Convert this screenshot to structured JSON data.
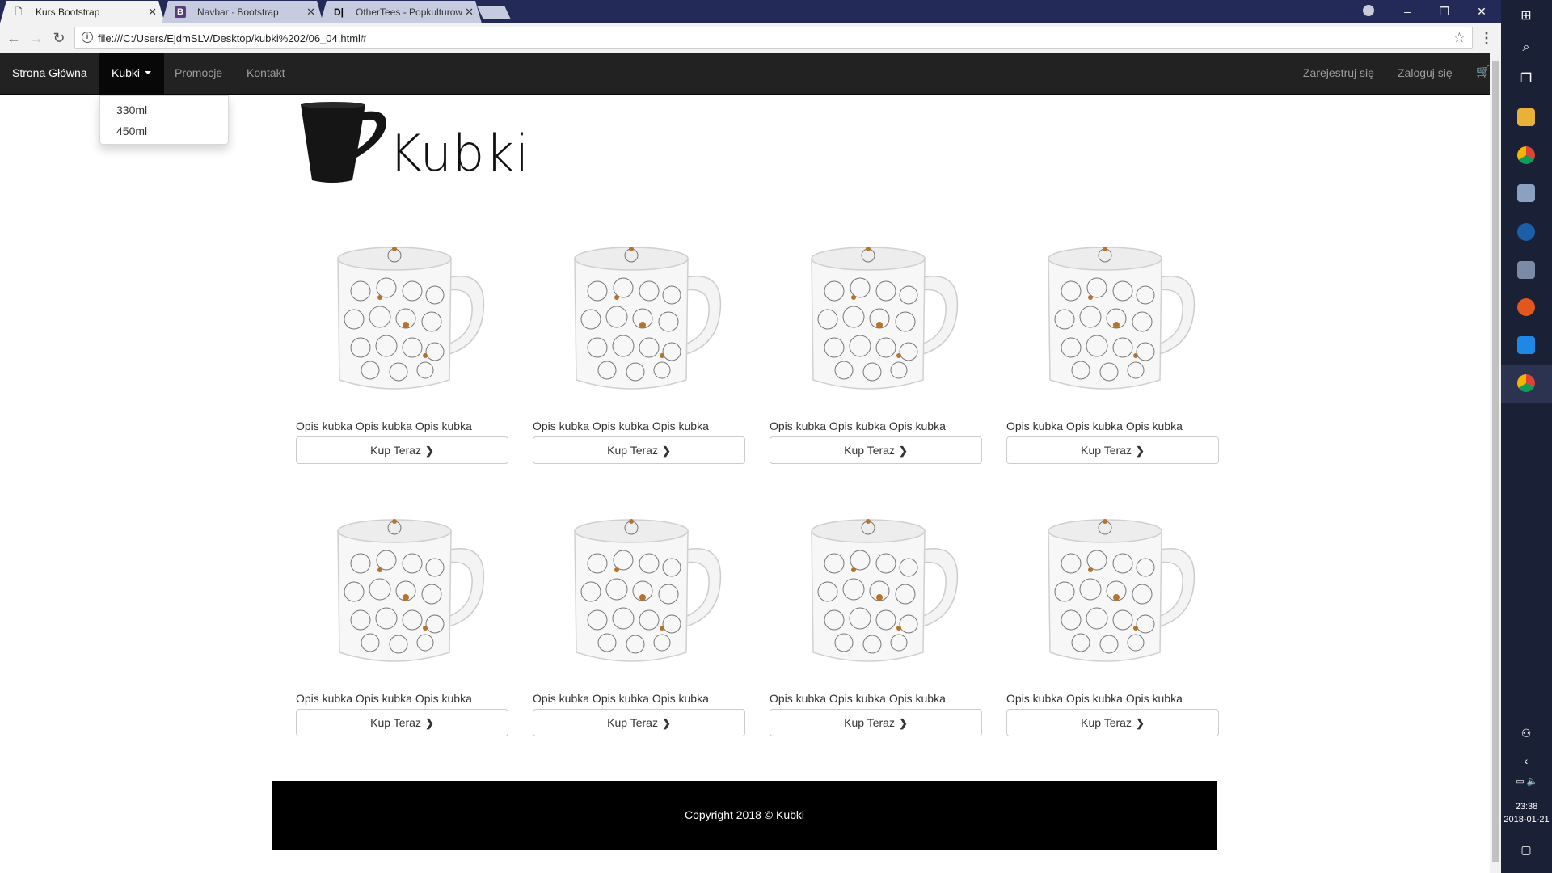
{
  "browser": {
    "tabs": [
      {
        "title": "Kurs Bootstrap",
        "favicon": "page-icon",
        "active": true
      },
      {
        "title": "Navbar · Bootstrap",
        "favicon": "B",
        "active": false
      },
      {
        "title": "OtherTees - Popkulturow",
        "favicon": "D|",
        "active": false
      }
    ],
    "url": "file:///C:/Users/EjdmSLV/Desktop/kubki%202/06_04.html#",
    "window_controls": {
      "minimize": "–",
      "restore": "❐",
      "close": "✕"
    }
  },
  "navbar": {
    "brand": "Strona Główna",
    "items": [
      {
        "label": "Kubki",
        "active": true,
        "dropdown": true
      },
      {
        "label": "Promocje"
      },
      {
        "label": "Kontakt"
      }
    ],
    "right": [
      {
        "label": "Zarejestruj się"
      },
      {
        "label": "Zaloguj się"
      }
    ],
    "cart_icon": "cart-icon"
  },
  "dropdown": {
    "items": [
      "330ml",
      "450ml"
    ]
  },
  "header": {
    "title": "Kubki"
  },
  "products": [
    {
      "desc": "Opis kubka Opis kubka Opis kubka",
      "button": "Kup Teraz"
    },
    {
      "desc": "Opis kubka Opis kubka Opis kubka",
      "button": "Kup Teraz"
    },
    {
      "desc": "Opis kubka Opis kubka Opis kubka",
      "button": "Kup Teraz"
    },
    {
      "desc": "Opis kubka Opis kubka Opis kubka",
      "button": "Kup Teraz"
    },
    {
      "desc": "Opis kubka Opis kubka Opis kubka",
      "button": "Kup Teraz"
    },
    {
      "desc": "Opis kubka Opis kubka Opis kubka",
      "button": "Kup Teraz"
    },
    {
      "desc": "Opis kubka Opis kubka Opis kubka",
      "button": "Kup Teraz"
    },
    {
      "desc": "Opis kubka Opis kubka Opis kubka",
      "button": "Kup Teraz"
    }
  ],
  "footer": {
    "copyright": "Copyright 2018 © Kubki"
  },
  "taskbar": {
    "time": "23:38",
    "date": "2018-01-21"
  },
  "colors": {
    "navbar_bg": "#222222",
    "navbar_active": "#080808",
    "tabstrip": "#232a57",
    "footer_bg": "#000000",
    "taskbar_bg": "#1a2036"
  }
}
